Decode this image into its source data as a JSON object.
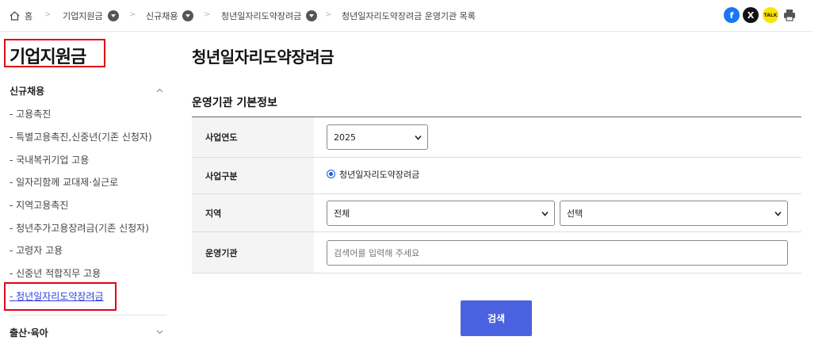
{
  "breadcrumb": {
    "home": "홈",
    "level1": "기업지원금",
    "level2": "신규채용",
    "level3": "청년일자리도약장려금",
    "current": "청년일자리도약장려금 운영기관 목록"
  },
  "share": {
    "facebook": "f",
    "x": "X",
    "kakaotalk": "TALK"
  },
  "sidebar": {
    "title": "기업지원금",
    "section1": "신규채용",
    "items": [
      "- 고용촉진",
      "- 특별고용촉진,신중년(기존 신청자)",
      "- 국내복귀기업 고용",
      "- 일자리함께 교대제·실근로",
      "- 지역고용촉진",
      "- 청년추가고용장려금(기존 신청자)",
      "- 고령자 고용",
      "- 신중년 적합직무 고용",
      "- 청년일자리도약장려금"
    ],
    "active_index": 8,
    "section2": "출산·육아"
  },
  "main": {
    "title": "청년일자리도약장려금",
    "subtitle": "운영기관 기본정보"
  },
  "form": {
    "year_label": "사업연도",
    "year_value": "2025",
    "type_label": "사업구분",
    "type_value": "청년일자리도약장려금",
    "region_label": "지역",
    "region_value": "전체",
    "region_sub_value": "선택",
    "org_label": "운영기관",
    "org_placeholder": "검색어를 입력해 주세요",
    "search_button": "검색"
  },
  "colors": {
    "accent": "#4a62e0",
    "active_link": "#2d3fe0",
    "highlight_box": "#e0001a"
  }
}
